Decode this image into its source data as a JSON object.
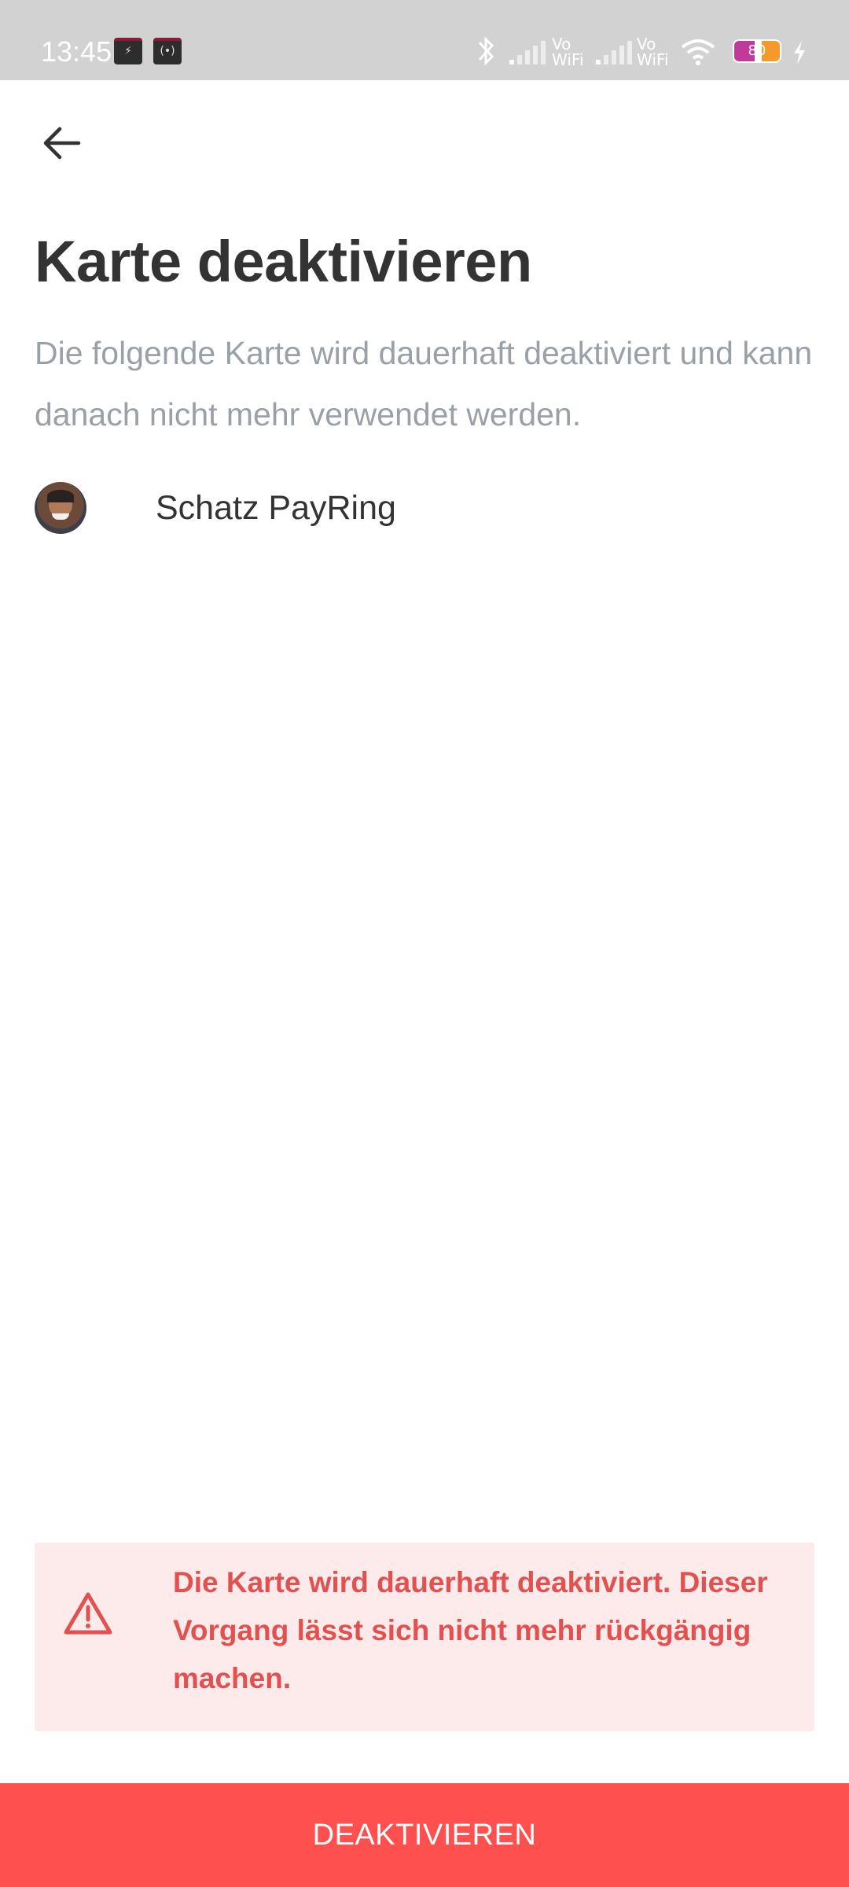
{
  "status_bar": {
    "time": "13:45",
    "battery": "80",
    "network_label_1": "Vo WiFi",
    "network_label_2": "Vo WiFi",
    "icons": [
      "app-icon-1",
      "app-icon-2",
      "bluetooth-icon",
      "signal-icon",
      "signal-icon",
      "wifi-icon",
      "battery-icon",
      "charging-icon"
    ]
  },
  "header": {
    "back_icon": "arrow-left-icon",
    "title": "Karte deaktivieren",
    "subtitle": "Die folgende Karte wird dauerhaft deaktiviert und kann danach nicht mehr verwendet werden."
  },
  "card": {
    "name": "Schatz PayRing",
    "avatar": "avatar"
  },
  "warning": {
    "icon": "warning-triangle-icon",
    "text": "Die Karte wird dauerhaft deaktiviert. Dieser Vorgang lässt sich nicht mehr rückgängig machen.",
    "color": "#e35050",
    "background": "#fdeaea"
  },
  "action": {
    "label": "DEAKTIVIEREN",
    "color": "#ff5050"
  }
}
